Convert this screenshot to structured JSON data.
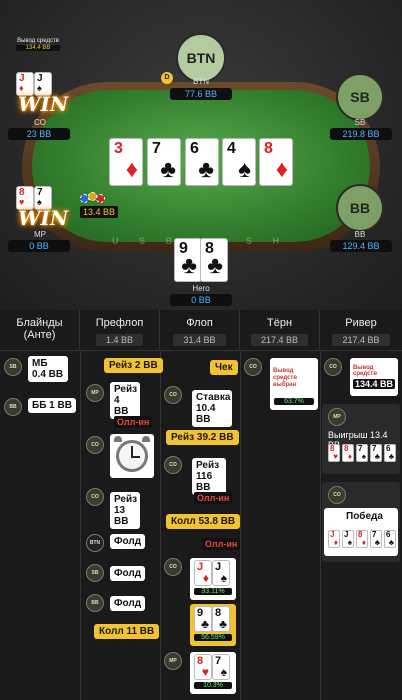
{
  "table": {
    "felt_text": "U S B C A S H",
    "withdraw": {
      "label": "Вывод средств",
      "amount": "134.4 BB"
    },
    "dealer_icon": "D",
    "seats": {
      "btn": {
        "circle": "BTN",
        "label": "BTN",
        "stack": "77.6 BB"
      },
      "sb": {
        "circle": "SB",
        "label": "SB",
        "stack": "219.8 BB"
      },
      "bb": {
        "circle": "BB",
        "label": "BB",
        "stack": "129.4 BB"
      },
      "co": {
        "label": "CO",
        "stack": "23 BB",
        "win": "WIN",
        "cards": [
          {
            "rank": "J",
            "suit": "♦"
          },
          {
            "rank": "J",
            "suit": "♠"
          }
        ]
      },
      "mp": {
        "label": "MP",
        "stack": "0 BB",
        "win": "WIN",
        "cards": [
          {
            "rank": "8",
            "suit": "♥"
          },
          {
            "rank": "7",
            "suit": "♠"
          }
        ],
        "bet": "13.4 BB"
      },
      "hero": {
        "label": "Hero",
        "stack": "0 BB",
        "cards": [
          {
            "rank": "9",
            "suit": "♣"
          },
          {
            "rank": "8",
            "suit": "♣"
          }
        ]
      }
    },
    "board": [
      {
        "rank": "3",
        "suit": "♦"
      },
      {
        "rank": "7",
        "suit": "♣"
      },
      {
        "rank": "6",
        "suit": "♣"
      },
      {
        "rank": "4",
        "suit": "♠"
      },
      {
        "rank": "8",
        "suit": "♦"
      }
    ]
  },
  "history": {
    "columns": [
      {
        "title": "Блайнды (Анте)",
        "sub": ""
      },
      {
        "title": "Префлоп",
        "sub": "1.4 BB"
      },
      {
        "title": "Флоп",
        "sub": "31.4 BB"
      },
      {
        "title": "Тёрн",
        "sub": "217.4 BB"
      },
      {
        "title": "Ривер",
        "sub": "217.4 BB"
      }
    ],
    "blinds": [
      {
        "pos": "SB",
        "text": "МБ 0.4 BB"
      },
      {
        "pos": "BB",
        "text": "ББ 1 BB"
      }
    ],
    "preflop": {
      "raise1": "Рейз 2 BB",
      "mp_pos": "MP",
      "mp_action": "Рейз 4 BB",
      "mp_allin": "Олл-ин",
      "co_pos": "CO",
      "co2_pos": "CO",
      "co_action": "Рейз 13 BB",
      "btn_pos": "BTN",
      "btn_action": "Фолд",
      "sb_pos": "SB",
      "sb_action": "Фолд",
      "bb_pos": "BB",
      "bb_action": "Фолд",
      "call": "Колл 11 BB"
    },
    "flop": {
      "check": "Чек",
      "co_pos": "CO",
      "bet": "Ставка 10.4 BB",
      "raise": "Рейз 39.2 BB",
      "co2_pos": "CO",
      "raise2": "Рейз 116 BB",
      "allin1": "Олл-ин",
      "call": "Колл 53.8 BB",
      "allin2": "Олл-ин",
      "co3_pos": "CO",
      "eq1_cards": [
        {
          "rank": "J",
          "suit": "♦"
        },
        {
          "rank": "J",
          "suit": "♠"
        }
      ],
      "eq1": "33.11%",
      "eq2_cards": [
        {
          "rank": "9",
          "suit": "♣"
        },
        {
          "rank": "8",
          "suit": "♣"
        }
      ],
      "eq2": "56.59%",
      "mp_pos": "MP",
      "eq3_cards": [
        {
          "rank": "8",
          "suit": "♥"
        },
        {
          "rank": "7",
          "suit": "♠"
        }
      ],
      "eq3": "10.3%"
    },
    "turn": {
      "co_pos": "CO",
      "withdraw_text": "Вывод средств выбран",
      "pct": "63.7%"
    },
    "river": {
      "co_pos": "CO",
      "withdraw_label": "Вывод средств",
      "withdraw_amount": "134.4 BB",
      "mp_pos": "MP",
      "mp_win": "Выигрыш 13.4 BB",
      "mp_hand": [
        {
          "rank": "8",
          "suit": "♥"
        },
        {
          "rank": "8",
          "suit": "♦"
        },
        {
          "rank": "7",
          "suit": "♠"
        },
        {
          "rank": "7",
          "suit": "♣"
        },
        {
          "rank": "6",
          "suit": "♣"
        }
      ],
      "co2_pos": "CO",
      "co_result": "Победа",
      "co_hand": [
        {
          "rank": "J",
          "suit": "♦"
        },
        {
          "rank": "J",
          "suit": "♠"
        },
        {
          "rank": "8",
          "suit": "♦"
        },
        {
          "rank": "7",
          "suit": "♣"
        },
        {
          "rank": "6",
          "suit": "♣"
        }
      ]
    }
  },
  "colors": {
    "felt": "#3d8d36",
    "stack_text": "#4fb4ff",
    "action_yellow": "#f1c232",
    "allin_red": "#e64a3a",
    "equity_green": "#6fe36f"
  }
}
